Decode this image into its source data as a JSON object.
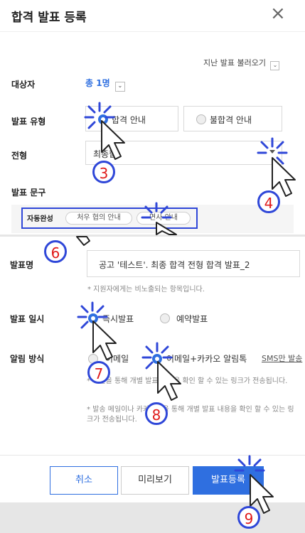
{
  "top": {
    "title": "합격 발표 등록",
    "close_glyph": "×",
    "load_past": "지난 발표 불러오기",
    "target_label": "대상자",
    "target_value": "총 1명",
    "type_label": "발표 유형",
    "type_pass": "합격 안내",
    "type_fail": "불합격 안내",
    "stage_label": "전형",
    "stage_value": "최종합",
    "phrase_label": "발표 문구",
    "autocomplete_label": "자동완성",
    "chip1": "처우 협의 안내",
    "chip2": "면사 안내"
  },
  "bottom": {
    "name_label": "발표명",
    "name_value": "공고 '테스트'. 최종 합격 전형 합격 발표_2",
    "name_hint": "* 지원자에게는 비노출되는 항목입니다.",
    "datetime_label": "발표 일시",
    "now": "즉시발표",
    "scheduled": "예약발표",
    "notify_label": "알림 방식",
    "email": "이메일",
    "email_kakao": "이메일+카카오 알림톡",
    "sms_only": "SMS만 발송",
    "hint1": "* 메일을 통해 개별 발표 내용을 확인 할 수 있는 링크가 전송됩니다.",
    "hint2": "* 발송 메일이나 카카오톡을 통해 개별 발표 내용을 확인 할 수 있는 링크가 전송됩니다.",
    "cancel": "취소",
    "preview": "미리보기",
    "submit": "발표등록"
  },
  "steps": [
    "3",
    "4",
    "6",
    "7",
    "8",
    "9"
  ],
  "colors": {
    "accent": "#2f6fe0",
    "annotation": "#2f47d8",
    "step_number": "#e01a1a"
  }
}
